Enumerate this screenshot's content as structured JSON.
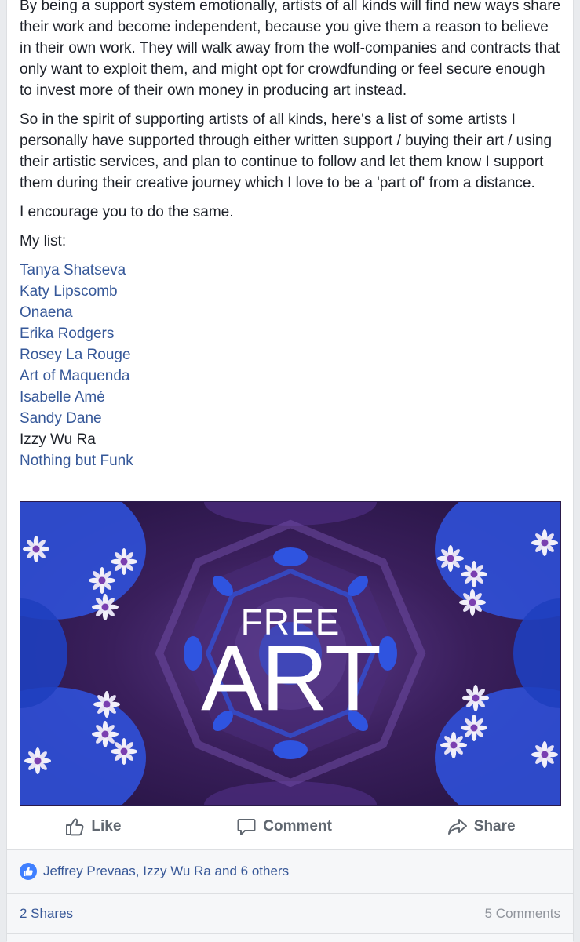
{
  "post": {
    "paragraphs": [
      "By being a support system emotionally, artists of all kinds will find new ways share their work and become independent, because you give them a reason to believe in their own work. They will walk away from the wolf-companies and contracts that only want to exploit them, and might opt for crowdfunding or feel secure enough to invest more of their own money in producing art instead.",
      "So in the spirit of supporting artists of all kinds, here's a list of some artists I personally have supported through either written support / buying their art / using their artistic services, and plan to continue to follow and let them know I support them during their creative journey which I love to be a 'part of' from a distance.",
      "I encourage you to do the same.",
      "My list:"
    ],
    "artists": [
      {
        "name": "Tanya Shatseva",
        "linked": true
      },
      {
        "name": "Katy Lipscomb",
        "linked": true
      },
      {
        "name": "Onaena",
        "linked": true
      },
      {
        "name": "Erika Rodgers",
        "linked": true
      },
      {
        "name": "Rosey La Rouge",
        "linked": true
      },
      {
        "name": "Art of Maquenda",
        "linked": true
      },
      {
        "name": "Isabelle Amé",
        "linked": true
      },
      {
        "name": "Sandy Dane",
        "linked": true
      },
      {
        "name": "Izzy Wu Ra",
        "linked": false
      },
      {
        "name": "Nothing but Funk",
        "linked": true
      }
    ],
    "image": {
      "line1": "FREE",
      "line2": "ART",
      "colors": {
        "deep_purple": "#3a1f5c",
        "mid_purple": "#5b3a8a",
        "royal_blue": "#2f54e0",
        "flower_white": "#f2f0fa",
        "flower_center": "#7a3fb0"
      }
    }
  },
  "actions": {
    "like": "Like",
    "comment": "Comment",
    "share": "Share"
  },
  "reactions": {
    "icon": "thumbs-up-icon",
    "names": "Jeffrey Prevaas, Izzy Wu Ra and 6 others"
  },
  "counts": {
    "shares": "2 Shares",
    "comments": "5 Comments"
  },
  "colors": {
    "link": "#365899",
    "text": "#1d2129",
    "muted": "#606770",
    "like_blue": "#4080ff"
  }
}
